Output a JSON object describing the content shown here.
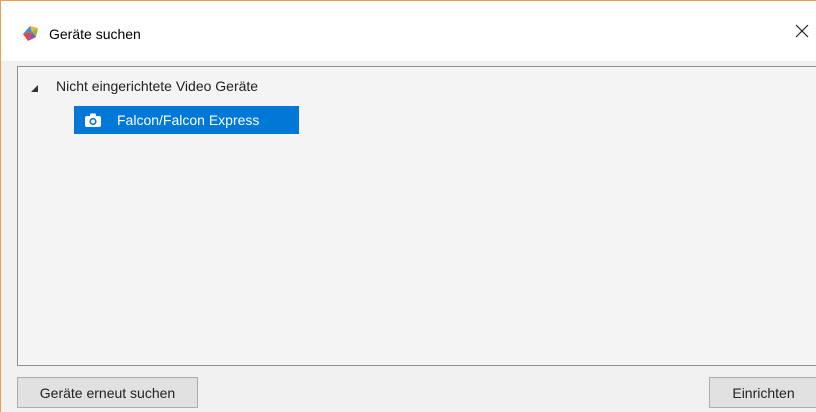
{
  "window": {
    "title": "Geräte suchen",
    "app_icon": "app-logo-icon",
    "close_icon": "close-icon",
    "border_color": "#e8a050"
  },
  "tree": {
    "root": {
      "label": "Nicht eingerichtete Video Geräte",
      "expanded": true,
      "expander_icon": "triangle-expanded-icon",
      "children": [
        {
          "label": "Falcon/Falcon Express",
          "icon": "camera-icon",
          "selected": true
        }
      ]
    }
  },
  "buttons": {
    "rescan_label": "Geräte erneut suchen",
    "setup_label": "Einrichten"
  },
  "colors": {
    "selection": "#0078d7",
    "selection_text": "#ffffff",
    "background": "#f0f0f0"
  }
}
